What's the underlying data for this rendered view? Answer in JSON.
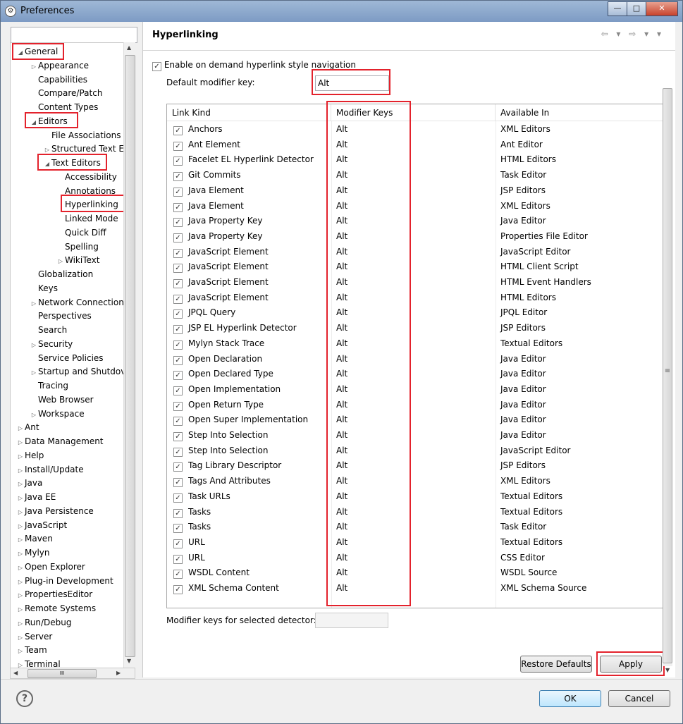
{
  "window": {
    "title": "Preferences",
    "minimize": "—",
    "maximize": "□",
    "close": "✕",
    "icon": "gear-icon"
  },
  "tree": {
    "items": [
      {
        "label": "General",
        "indent": 0,
        "toggle": "◢"
      },
      {
        "label": "Appearance",
        "indent": 1,
        "toggle": "▷"
      },
      {
        "label": "Capabilities",
        "indent": 1,
        "toggle": ""
      },
      {
        "label": "Compare/Patch",
        "indent": 1,
        "toggle": ""
      },
      {
        "label": "Content Types",
        "indent": 1,
        "toggle": ""
      },
      {
        "label": "Editors",
        "indent": 0.5,
        "toggle": "◢"
      },
      {
        "label": "File Associations",
        "indent": 2,
        "toggle": ""
      },
      {
        "label": "Structured Text E",
        "indent": 2,
        "toggle": "▷"
      },
      {
        "label": "Text Editors",
        "indent": 1.5,
        "toggle": "◢"
      },
      {
        "label": "Accessibility",
        "indent": 3,
        "toggle": ""
      },
      {
        "label": "Annotations",
        "indent": 3,
        "toggle": ""
      },
      {
        "label": "Hyperlinking",
        "indent": 3,
        "toggle": ""
      },
      {
        "label": "Linked Mode",
        "indent": 3,
        "toggle": ""
      },
      {
        "label": "Quick Diff",
        "indent": 3,
        "toggle": ""
      },
      {
        "label": "Spelling",
        "indent": 3,
        "toggle": ""
      },
      {
        "label": "WikiText",
        "indent": 3,
        "toggle": "▷"
      },
      {
        "label": "Globalization",
        "indent": 1,
        "toggle": ""
      },
      {
        "label": "Keys",
        "indent": 1,
        "toggle": ""
      },
      {
        "label": "Network Connection",
        "indent": 1,
        "toggle": "▷"
      },
      {
        "label": "Perspectives",
        "indent": 1,
        "toggle": ""
      },
      {
        "label": "Search",
        "indent": 1,
        "toggle": ""
      },
      {
        "label": "Security",
        "indent": 1,
        "toggle": "▷"
      },
      {
        "label": "Service Policies",
        "indent": 1,
        "toggle": ""
      },
      {
        "label": "Startup and Shutdov",
        "indent": 1,
        "toggle": "▷"
      },
      {
        "label": "Tracing",
        "indent": 1,
        "toggle": ""
      },
      {
        "label": "Web Browser",
        "indent": 1,
        "toggle": ""
      },
      {
        "label": "Workspace",
        "indent": 1,
        "toggle": "▷"
      },
      {
        "label": "Ant",
        "indent": 0,
        "toggle": "▷"
      },
      {
        "label": "Data Management",
        "indent": 0,
        "toggle": "▷"
      },
      {
        "label": "Help",
        "indent": 0,
        "toggle": "▷"
      },
      {
        "label": "Install/Update",
        "indent": 0,
        "toggle": "▷"
      },
      {
        "label": "Java",
        "indent": 0,
        "toggle": "▷"
      },
      {
        "label": "Java EE",
        "indent": 0,
        "toggle": "▷"
      },
      {
        "label": "Java Persistence",
        "indent": 0,
        "toggle": "▷"
      },
      {
        "label": "JavaScript",
        "indent": 0,
        "toggle": "▷"
      },
      {
        "label": "Maven",
        "indent": 0,
        "toggle": "▷"
      },
      {
        "label": "Mylyn",
        "indent": 0,
        "toggle": "▷"
      },
      {
        "label": "Open Explorer",
        "indent": 0,
        "toggle": "▷"
      },
      {
        "label": "Plug-in Development",
        "indent": 0,
        "toggle": "▷"
      },
      {
        "label": "PropertiesEditor",
        "indent": 0,
        "toggle": "▷"
      },
      {
        "label": "Remote Systems",
        "indent": 0,
        "toggle": "▷"
      },
      {
        "label": "Run/Debug",
        "indent": 0,
        "toggle": "▷"
      },
      {
        "label": "Server",
        "indent": 0,
        "toggle": "▷"
      },
      {
        "label": "Team",
        "indent": 0,
        "toggle": "▷"
      },
      {
        "label": "Terminal",
        "indent": 0,
        "toggle": "▷"
      }
    ],
    "scroll_grip": "III"
  },
  "page": {
    "title": "Hyperlinking",
    "nav_arrows": "⇦ ▾ ⇨ ▾ ▾",
    "enable_label": "Enable on demand hyperlink style navigation",
    "enable_checked": "✓",
    "default_modifier_label": "Default modifier key:",
    "default_modifier_value": "Alt",
    "selected_detector_label": "Modifier keys for selected detector:",
    "columns": [
      "Link Kind",
      "Modifier Keys",
      "Available In"
    ],
    "rows": [
      [
        "Anchors",
        "Alt",
        "XML Editors"
      ],
      [
        "Ant Element",
        "Alt",
        "Ant Editor"
      ],
      [
        "Facelet EL Hyperlink Detector",
        "Alt",
        "HTML Editors"
      ],
      [
        "Git Commits",
        "Alt",
        "Task Editor"
      ],
      [
        "Java Element",
        "Alt",
        "JSP Editors"
      ],
      [
        "Java Element",
        "Alt",
        "XML Editors"
      ],
      [
        "Java Property Key",
        "Alt",
        "Java Editor"
      ],
      [
        "Java Property Key",
        "Alt",
        "Properties File Editor"
      ],
      [
        "JavaScript Element",
        "Alt",
        "JavaScript Editor"
      ],
      [
        "JavaScript Element",
        "Alt",
        "HTML Client Script"
      ],
      [
        "JavaScript Element",
        "Alt",
        "HTML Event Handlers"
      ],
      [
        "JavaScript Element",
        "Alt",
        "HTML Editors"
      ],
      [
        "JPQL Query",
        "Alt",
        "JPQL Editor"
      ],
      [
        "JSP EL Hyperlink Detector",
        "Alt",
        "JSP Editors"
      ],
      [
        "Mylyn Stack Trace",
        "Alt",
        "Textual Editors"
      ],
      [
        "Open Declaration",
        "Alt",
        "Java Editor"
      ],
      [
        "Open Declared Type",
        "Alt",
        "Java Editor"
      ],
      [
        "Open Implementation",
        "Alt",
        "Java Editor"
      ],
      [
        "Open Return Type",
        "Alt",
        "Java Editor"
      ],
      [
        "Open Super Implementation",
        "Alt",
        "Java Editor"
      ],
      [
        "Step Into Selection",
        "Alt",
        "Java Editor"
      ],
      [
        "Step Into Selection",
        "Alt",
        "JavaScript Editor"
      ],
      [
        "Tag Library Descriptor",
        "Alt",
        "JSP Editors"
      ],
      [
        "Tags And Attributes",
        "Alt",
        "XML Editors"
      ],
      [
        "Task URLs",
        "Alt",
        "Textual Editors"
      ],
      [
        "Tasks",
        "Alt",
        "Textual Editors"
      ],
      [
        "Tasks",
        "Alt",
        "Task Editor"
      ],
      [
        "URL",
        "Alt",
        "Textual Editors"
      ],
      [
        "URL",
        "Alt",
        "CSS Editor"
      ],
      [
        "WSDL Content",
        "Alt",
        "WSDL Source"
      ],
      [
        "XML Schema Content",
        "Alt",
        "XML Schema Source"
      ]
    ],
    "restore_defaults": "Restore Defaults",
    "apply": "Apply",
    "vscroll_grip": "≡"
  },
  "footer": {
    "help": "?",
    "ok": "OK",
    "cancel": "Cancel"
  },
  "colors": {
    "highlight": "#e3222c",
    "titlebar": "#7d9bc4",
    "selected_tree_bg": "#ffffff"
  }
}
